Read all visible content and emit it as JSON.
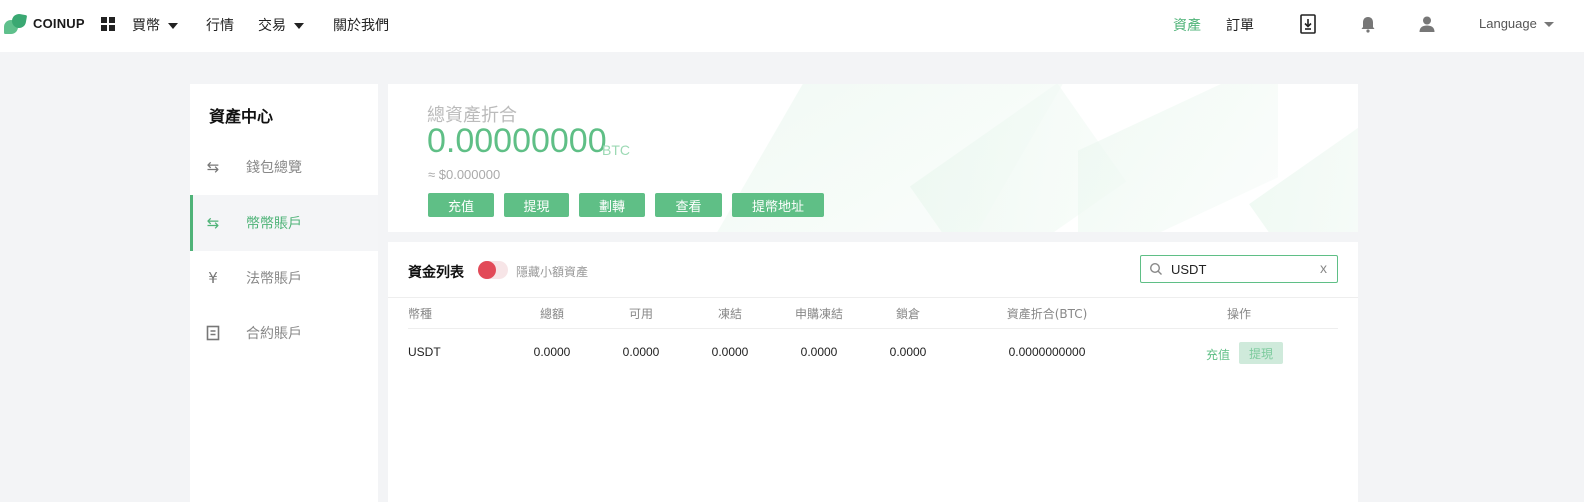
{
  "brand": {
    "name": "COINUP"
  },
  "nav": {
    "buy": "買幣",
    "market": "行情",
    "trade": "交易",
    "about": "關於我們"
  },
  "nav_right": {
    "assets": "資產",
    "orders": "訂單",
    "language": "Language"
  },
  "sidebar": {
    "title": "資產中心",
    "items": [
      {
        "label": "錢包總覽",
        "icon": "exchange-arrows-icon"
      },
      {
        "label": "幣幣賬戶",
        "icon": "exchange-arrows-icon",
        "active": true
      },
      {
        "label": "法幣賬戶",
        "icon": "yen-icon"
      },
      {
        "label": "合約賬戶",
        "icon": "document-icon"
      }
    ]
  },
  "summary": {
    "label": "總資產折合",
    "value": "0.00000000",
    "unit": "BTC",
    "usd": "≈ $0.000000",
    "buttons": [
      "充值",
      "提現",
      "劃轉",
      "查看",
      "提幣地址"
    ]
  },
  "assets": {
    "title": "資金列表",
    "hide_small_label": "隱藏小額資產",
    "hide_small_enabled": true,
    "search_value": "USDT",
    "clear_label": "x",
    "columns": [
      "幣種",
      "總額",
      "可用",
      "凍結",
      "申購凍結",
      "鎖倉",
      "資產折合(BTC)",
      "操作"
    ],
    "rows": [
      {
        "coin": "USDT",
        "total": "0.0000",
        "available": "0.0000",
        "frozen": "0.0000",
        "purchase_frozen": "0.0000",
        "locked": "0.0000",
        "btc_value": "0.0000000000",
        "deposit": "充值",
        "withdraw": "提現"
      }
    ]
  },
  "colors": {
    "accent": "#5fbf86",
    "toggle_on": "#e24a58",
    "background": "#f3f4f6"
  }
}
